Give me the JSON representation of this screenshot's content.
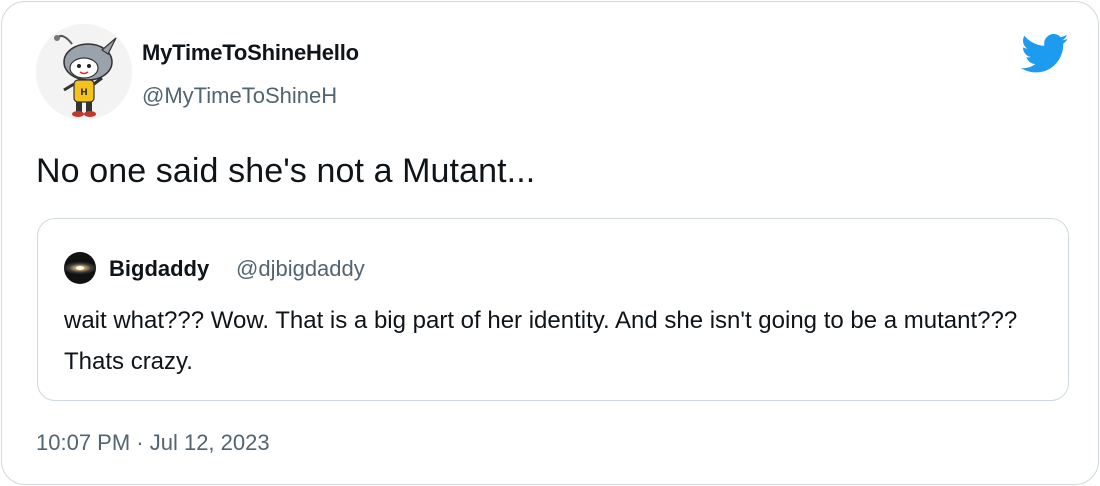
{
  "tweet": {
    "author": {
      "display_name": "MyTimeToShineHello",
      "handle": "@MyTimeToShineH",
      "avatar_icon": "cartoon-character-avatar"
    },
    "text": "No one said she's not a Mutant...",
    "timestamp": "10:07 PM · Jul 12, 2023",
    "brand_icon": "twitter-bird-icon",
    "brand_color": "#1d9bf0"
  },
  "quoted_tweet": {
    "author": {
      "display_name": "Bigdaddy",
      "handle": "@djbigdaddy",
      "avatar_icon": "galaxy-avatar"
    },
    "text": "wait what???  Wow. That is a big part of her identity. And she isn't going to be a mutant??? Thats crazy."
  },
  "colors": {
    "text_primary": "#0f1419",
    "text_secondary": "#536471",
    "border": "#cfd9de"
  }
}
